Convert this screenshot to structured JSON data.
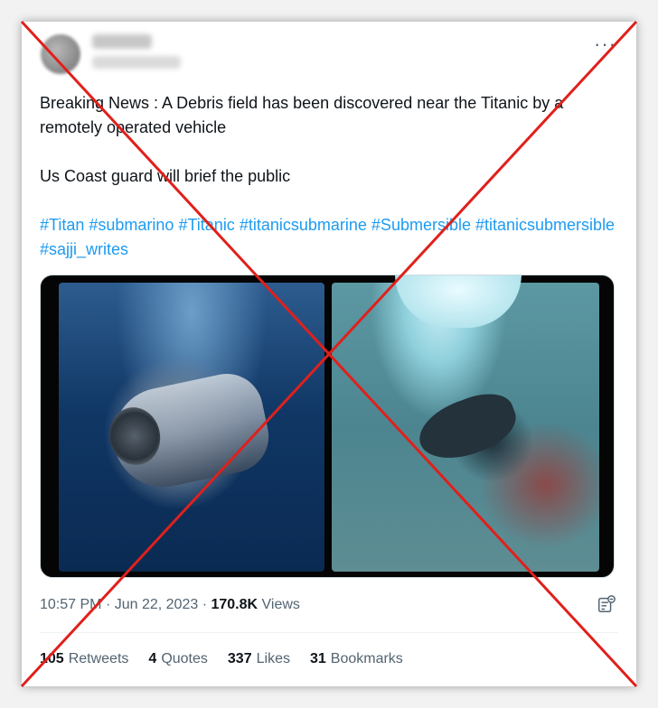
{
  "tweet": {
    "more_label": "···",
    "text_line1": "Breaking News : A Debris field has been discovered near the Titanic by a remotely operated vehicle",
    "text_line2": "Us Coast guard will brief the public",
    "hashtags": [
      "#Titan",
      "#submarino",
      "#Titanic",
      "#titanicsubmarine",
      "#Submersible",
      "#titanicsubmersible",
      "#sajji_writes"
    ],
    "time": "10:57 PM",
    "date": "Jun 22, 2023",
    "views_count": "170.8K",
    "views_label": "Views",
    "stats": {
      "retweets_count": "105",
      "retweets_label": "Retweets",
      "quotes_count": "4",
      "quotes_label": "Quotes",
      "likes_count": "337",
      "likes_label": "Likes",
      "bookmarks_count": "31",
      "bookmarks_label": "Bookmarks"
    }
  },
  "icons": {
    "more": "more-dots-icon",
    "analytics": "analytics-icon"
  },
  "colors": {
    "link": "#1d9bf0",
    "text": "#0f1419",
    "muted": "#536471",
    "cross": "#e0201b"
  }
}
